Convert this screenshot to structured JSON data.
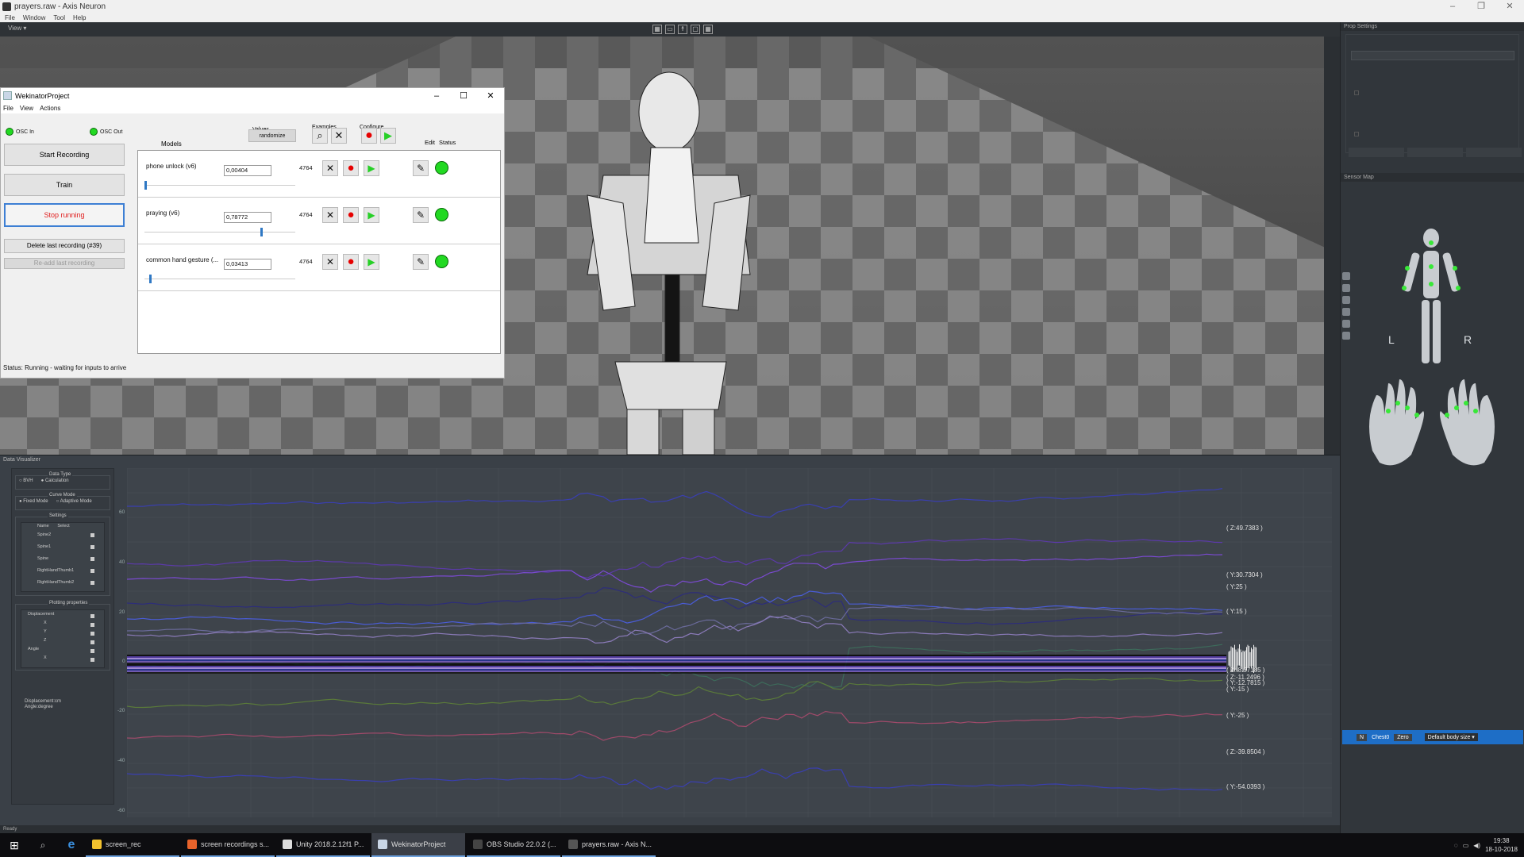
{
  "app": {
    "title": "prayers.raw - Axis Neuron",
    "menu": [
      "File",
      "Window",
      "Tool",
      "Help"
    ],
    "view_label": "View"
  },
  "right_panel": {
    "prop_settings_title": "Prop Settings",
    "sensor_map_title": "Sensor Map",
    "left_label": "L",
    "right_label": "R",
    "bottom_bar": {
      "n_label": "N",
      "item": "Chest0",
      "zero_btn": "Zero",
      "body_size": "Default body size"
    }
  },
  "wekinator": {
    "title": "WekinatorProject",
    "menu": [
      "File",
      "View",
      "Actions"
    ],
    "osc_in": "OSC In",
    "osc_out": "OSC Out",
    "buttons": {
      "start_recording": "Start Recording",
      "train": "Train",
      "stop_running": "Stop running",
      "delete_last": "Delete last recording (#39)",
      "readd_last": "Re-add last recording"
    },
    "headers": {
      "models": "Models",
      "values": "Values",
      "randomize": "randomize",
      "examples": "Examples",
      "configure": "Configure",
      "edit": "Edit",
      "status": "Status"
    },
    "models": [
      {
        "name": "phone unlock (v6)",
        "value": "0,00404",
        "count": "4764",
        "level": 0.0
      },
      {
        "name": "praying (v6)",
        "value": "0,78772",
        "count": "4764",
        "level": 0.79
      },
      {
        "name": "common hand gesture (...",
        "value": "0,03413",
        "count": "4764",
        "level": 0.03
      }
    ],
    "status": "Status:  Running - waiting for inputs to arrive"
  },
  "data_viewer": {
    "title": "Data Visualizer",
    "data_type": {
      "title": "Data Type",
      "options": [
        "BVH",
        "Calculation"
      ]
    },
    "curve_mode": {
      "title": "Curve Mode",
      "options": [
        "Fixed Mode",
        "Adaptive Mode"
      ]
    },
    "settings": {
      "title": "Settings",
      "col_name": "Name",
      "col_select": "Select",
      "items": [
        "Spine2",
        "Spine1",
        "Spine",
        "RightHandThumb1",
        "RightHandThumb2"
      ]
    },
    "plotting": {
      "title": "Plotting properties",
      "items": [
        "Displacement",
        "X",
        "Y",
        "Z",
        "Angle",
        "X"
      ]
    },
    "units": [
      "Displacement:cm",
      "Angle:degree"
    ],
    "y_ticks": [
      "60",
      "40",
      "20",
      "0",
      "-20",
      "-40",
      "-60"
    ],
    "value_labels": [
      "( Z:49.7383 )",
      "( Y:30.7304 )",
      "( Y:25 )",
      "( Y:15 )",
      "( Z:-8.57185 )",
      "( Z:-11.2496 )",
      "( Y:-12.7815 )",
      "( Y:-15 )",
      "( Y:-25 )",
      "( Z:-39.8504 )",
      "( Y:-54.0393 )"
    ]
  },
  "status_bar": "Ready",
  "taskbar": {
    "items": [
      {
        "label": "screen_rec",
        "color": "#f2c12e"
      },
      {
        "label": "screen recordings s...",
        "color": "#e8632b"
      },
      {
        "label": "Unity 2018.2.12f1 P...",
        "color": "#dddddd"
      },
      {
        "label": "WekinatorProject",
        "color": "#c9d6e6"
      },
      {
        "label": "OBS Studio 22.0.2 (...",
        "color": "#444444"
      },
      {
        "label": "prayers.raw - Axis N...",
        "color": "#555555"
      }
    ],
    "time": "19:38",
    "date": "18-10-2018"
  }
}
